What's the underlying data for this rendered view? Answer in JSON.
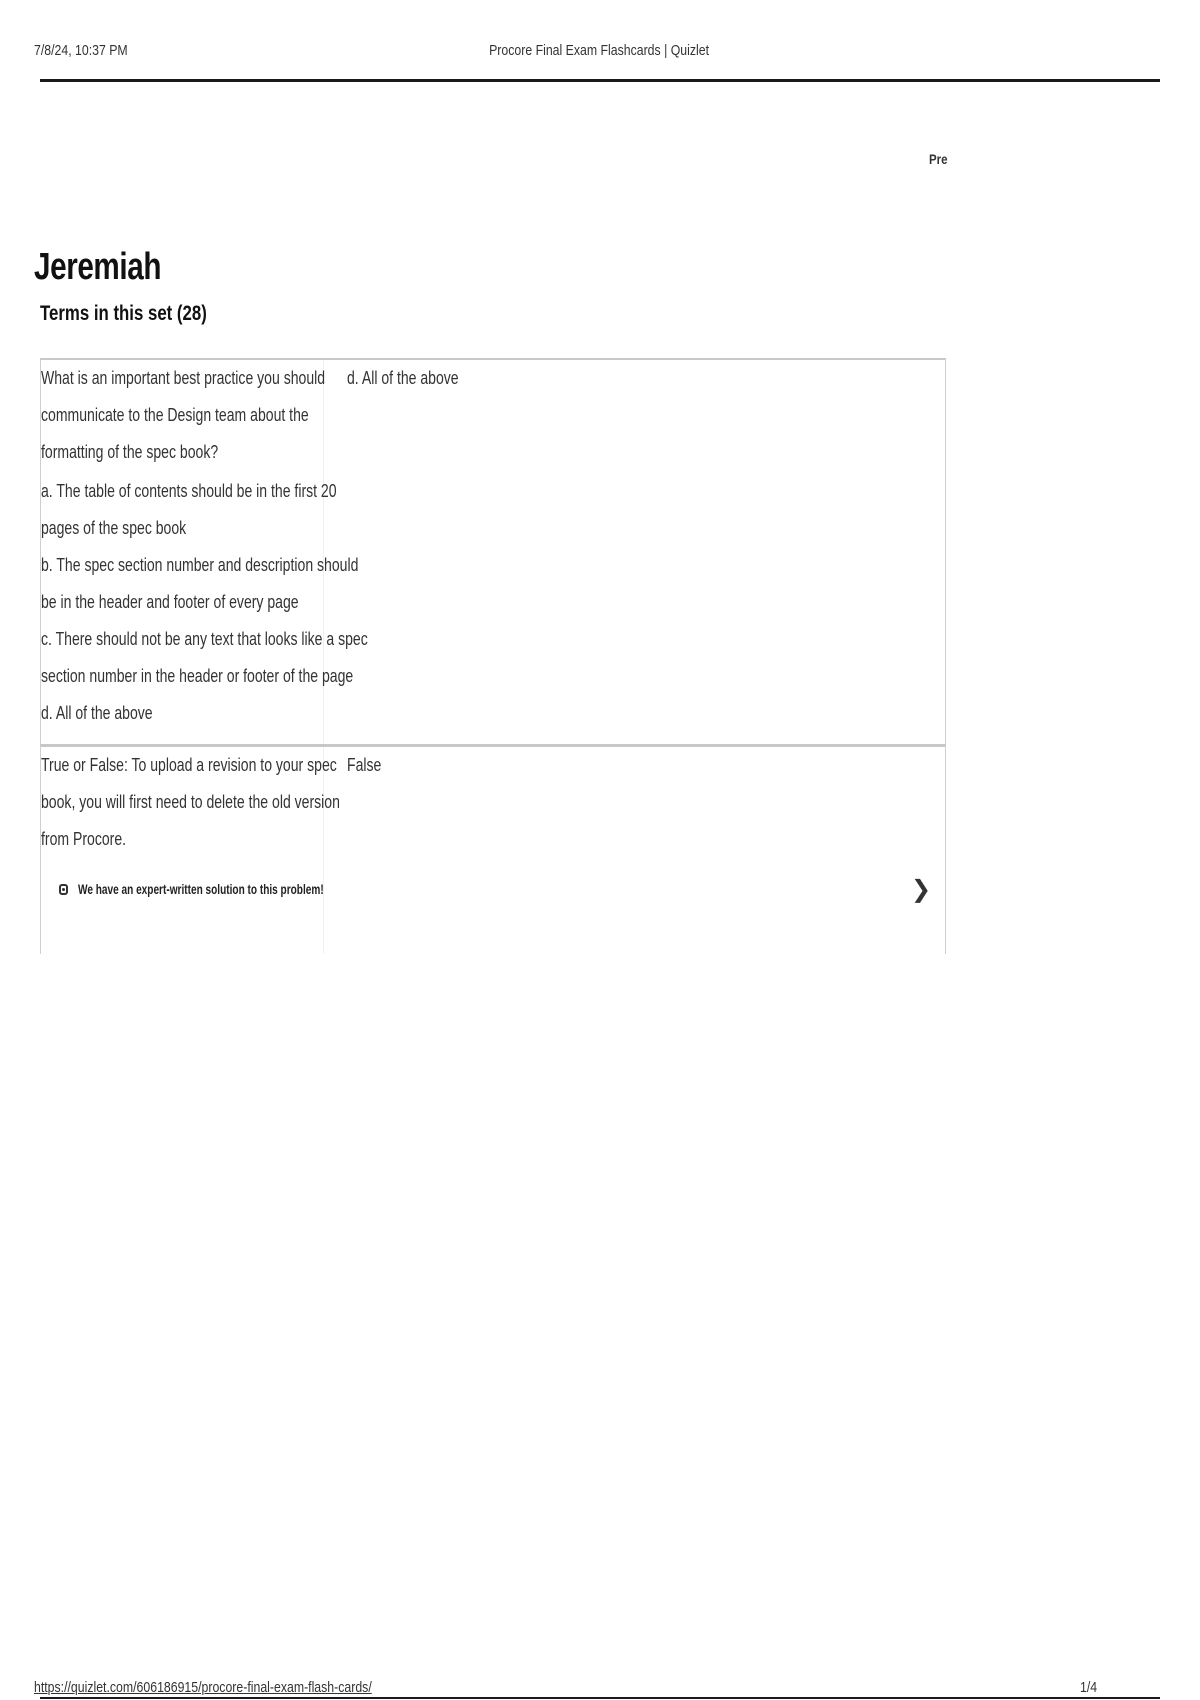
{
  "print_header": {
    "datetime": "7/8/24, 10:37 PM",
    "page_title": "Procore Final Exam Flashcards | Quizlet"
  },
  "pre_label": "Pre",
  "set": {
    "author": "Jeremiah",
    "terms_heading": "Terms in this set (28)"
  },
  "cards": [
    {
      "term_lines": [
        "What is an important best practice you should",
        "communicate to the Design team about the",
        "formatting of the spec book?",
        "a. The table of contents should be in the first 20",
        "pages of the spec book",
        "b. The spec section number and description should",
        "be in the header and footer of every page",
        "c. There should not be any text that looks like a spec",
        "section number in the header or footer of the page",
        "d. All of the above"
      ],
      "definition": "d. All of the above"
    },
    {
      "term_lines": [
        "True or False: To upload a revision to your spec",
        "book, you will first need to delete the old version",
        "from Procore."
      ],
      "definition": "False",
      "solution_banner": "We have an expert-written solution to this problem!",
      "chevron_icon": "chevron-right-icon"
    }
  ],
  "print_footer": {
    "url": "https://quizlet.com/606186915/procore-final-exam-flash-cards/",
    "page_number": "1/4"
  }
}
